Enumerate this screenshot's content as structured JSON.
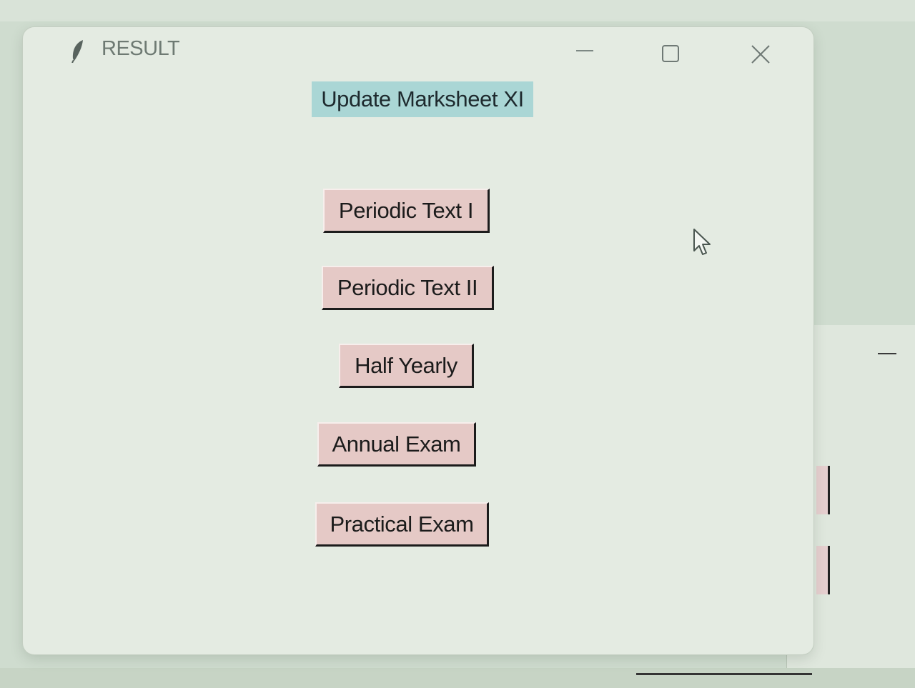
{
  "window": {
    "title": "RESULT"
  },
  "controls": {
    "minimize_icon": "minimize-icon",
    "maximize_icon": "maximize-icon",
    "close_icon": "close-icon"
  },
  "heading": "Update Marksheet XI",
  "buttons": [
    {
      "label": "Periodic Text I"
    },
    {
      "label": "Periodic Text II"
    },
    {
      "label": "Half Yearly"
    },
    {
      "label": "Annual Exam"
    },
    {
      "label": "Practical Exam"
    }
  ],
  "colors": {
    "heading_bg": "#aad6d5",
    "button_bg": "#e5c9c6",
    "window_bg": "#e4ebe2"
  }
}
